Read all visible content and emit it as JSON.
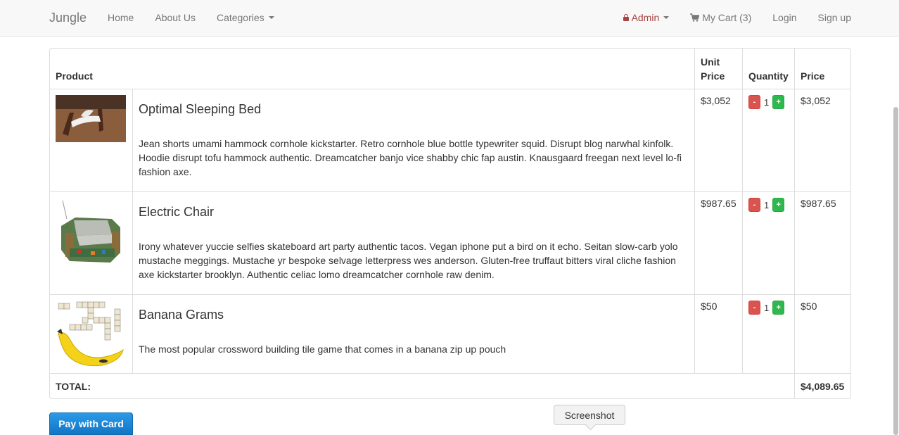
{
  "navbar": {
    "brand": "Jungle",
    "left_links": [
      "Home",
      "About Us",
      "Categories"
    ],
    "admin_label": "Admin",
    "cart_label": "My Cart (3)",
    "login_label": "Login",
    "signup_label": "Sign up"
  },
  "table": {
    "headers": {
      "product": "Product",
      "unit_price": "Unit Price",
      "quantity": "Quantity",
      "price": "Price"
    },
    "rows": [
      {
        "name": "Optimal Sleeping Bed",
        "description": "Jean shorts umami hammock cornhole kickstarter. Retro cornhole blue bottle typewriter squid. Disrupt blog narwhal kinfolk. Hoodie disrupt tofu hammock authentic. Dreamcatcher banjo vice shabby chic fap austin. Knausgaard freegan next level lo-fi fashion axe.",
        "unit_price": "$3,052",
        "quantity": "1",
        "price": "$3,052"
      },
      {
        "name": "Electric Chair",
        "description": "Irony whatever yuccie selfies skateboard art party authentic tacos. Vegan iphone put a bird on it echo. Seitan slow-carb yolo mustache meggings. Mustache yr bespoke selvage letterpress wes anderson. Gluten-free truffaut bitters viral cliche fashion axe kickstarter brooklyn. Authentic celiac lomo dreamcatcher cornhole raw denim.",
        "unit_price": "$987.65",
        "quantity": "1",
        "price": "$987.65"
      },
      {
        "name": "Banana Grams",
        "description": "The most popular crossword building tile game that comes in a banana zip up pouch",
        "unit_price": "$50",
        "quantity": "1",
        "price": "$50"
      }
    ],
    "qty_minus": "-",
    "qty_plus": "+",
    "total_label": "TOTAL:",
    "total_value": "$4,089.65"
  },
  "pay_button": "Pay with Card",
  "tooltip": "Screenshot",
  "colors": {
    "admin": "#a94442",
    "minus": "#d9534f",
    "plus": "#2fb84d",
    "pay": "#1a86d6"
  }
}
